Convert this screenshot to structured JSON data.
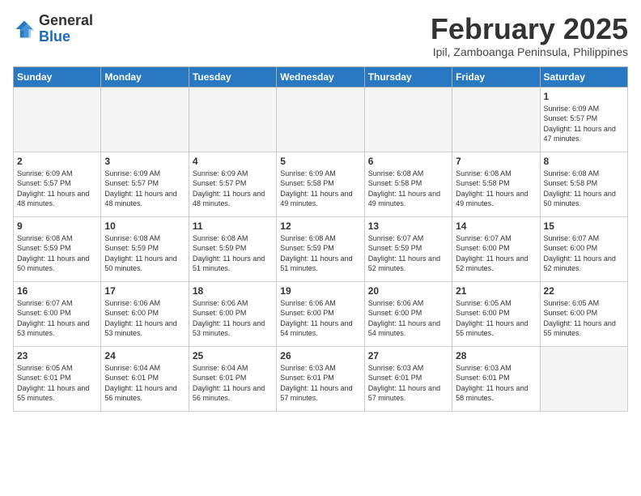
{
  "header": {
    "logo_general": "General",
    "logo_blue": "Blue",
    "month_title": "February 2025",
    "subtitle": "Ipil, Zamboanga Peninsula, Philippines"
  },
  "weekdays": [
    "Sunday",
    "Monday",
    "Tuesday",
    "Wednesday",
    "Thursday",
    "Friday",
    "Saturday"
  ],
  "weeks": [
    [
      {
        "day": "",
        "info": ""
      },
      {
        "day": "",
        "info": ""
      },
      {
        "day": "",
        "info": ""
      },
      {
        "day": "",
        "info": ""
      },
      {
        "day": "",
        "info": ""
      },
      {
        "day": "",
        "info": ""
      },
      {
        "day": "1",
        "info": "Sunrise: 6:09 AM\nSunset: 5:57 PM\nDaylight: 11 hours and 47 minutes."
      }
    ],
    [
      {
        "day": "2",
        "info": "Sunrise: 6:09 AM\nSunset: 5:57 PM\nDaylight: 11 hours and 48 minutes."
      },
      {
        "day": "3",
        "info": "Sunrise: 6:09 AM\nSunset: 5:57 PM\nDaylight: 11 hours and 48 minutes."
      },
      {
        "day": "4",
        "info": "Sunrise: 6:09 AM\nSunset: 5:57 PM\nDaylight: 11 hours and 48 minutes."
      },
      {
        "day": "5",
        "info": "Sunrise: 6:09 AM\nSunset: 5:58 PM\nDaylight: 11 hours and 49 minutes."
      },
      {
        "day": "6",
        "info": "Sunrise: 6:08 AM\nSunset: 5:58 PM\nDaylight: 11 hours and 49 minutes."
      },
      {
        "day": "7",
        "info": "Sunrise: 6:08 AM\nSunset: 5:58 PM\nDaylight: 11 hours and 49 minutes."
      },
      {
        "day": "8",
        "info": "Sunrise: 6:08 AM\nSunset: 5:58 PM\nDaylight: 11 hours and 50 minutes."
      }
    ],
    [
      {
        "day": "9",
        "info": "Sunrise: 6:08 AM\nSunset: 5:59 PM\nDaylight: 11 hours and 50 minutes."
      },
      {
        "day": "10",
        "info": "Sunrise: 6:08 AM\nSunset: 5:59 PM\nDaylight: 11 hours and 50 minutes."
      },
      {
        "day": "11",
        "info": "Sunrise: 6:08 AM\nSunset: 5:59 PM\nDaylight: 11 hours and 51 minutes."
      },
      {
        "day": "12",
        "info": "Sunrise: 6:08 AM\nSunset: 5:59 PM\nDaylight: 11 hours and 51 minutes."
      },
      {
        "day": "13",
        "info": "Sunrise: 6:07 AM\nSunset: 5:59 PM\nDaylight: 11 hours and 52 minutes."
      },
      {
        "day": "14",
        "info": "Sunrise: 6:07 AM\nSunset: 6:00 PM\nDaylight: 11 hours and 52 minutes."
      },
      {
        "day": "15",
        "info": "Sunrise: 6:07 AM\nSunset: 6:00 PM\nDaylight: 11 hours and 52 minutes."
      }
    ],
    [
      {
        "day": "16",
        "info": "Sunrise: 6:07 AM\nSunset: 6:00 PM\nDaylight: 11 hours and 53 minutes."
      },
      {
        "day": "17",
        "info": "Sunrise: 6:06 AM\nSunset: 6:00 PM\nDaylight: 11 hours and 53 minutes."
      },
      {
        "day": "18",
        "info": "Sunrise: 6:06 AM\nSunset: 6:00 PM\nDaylight: 11 hours and 53 minutes."
      },
      {
        "day": "19",
        "info": "Sunrise: 6:06 AM\nSunset: 6:00 PM\nDaylight: 11 hours and 54 minutes."
      },
      {
        "day": "20",
        "info": "Sunrise: 6:06 AM\nSunset: 6:00 PM\nDaylight: 11 hours and 54 minutes."
      },
      {
        "day": "21",
        "info": "Sunrise: 6:05 AM\nSunset: 6:00 PM\nDaylight: 11 hours and 55 minutes."
      },
      {
        "day": "22",
        "info": "Sunrise: 6:05 AM\nSunset: 6:00 PM\nDaylight: 11 hours and 55 minutes."
      }
    ],
    [
      {
        "day": "23",
        "info": "Sunrise: 6:05 AM\nSunset: 6:01 PM\nDaylight: 11 hours and 55 minutes."
      },
      {
        "day": "24",
        "info": "Sunrise: 6:04 AM\nSunset: 6:01 PM\nDaylight: 11 hours and 56 minutes."
      },
      {
        "day": "25",
        "info": "Sunrise: 6:04 AM\nSunset: 6:01 PM\nDaylight: 11 hours and 56 minutes."
      },
      {
        "day": "26",
        "info": "Sunrise: 6:03 AM\nSunset: 6:01 PM\nDaylight: 11 hours and 57 minutes."
      },
      {
        "day": "27",
        "info": "Sunrise: 6:03 AM\nSunset: 6:01 PM\nDaylight: 11 hours and 57 minutes."
      },
      {
        "day": "28",
        "info": "Sunrise: 6:03 AM\nSunset: 6:01 PM\nDaylight: 11 hours and 58 minutes."
      },
      {
        "day": "",
        "info": ""
      }
    ]
  ]
}
